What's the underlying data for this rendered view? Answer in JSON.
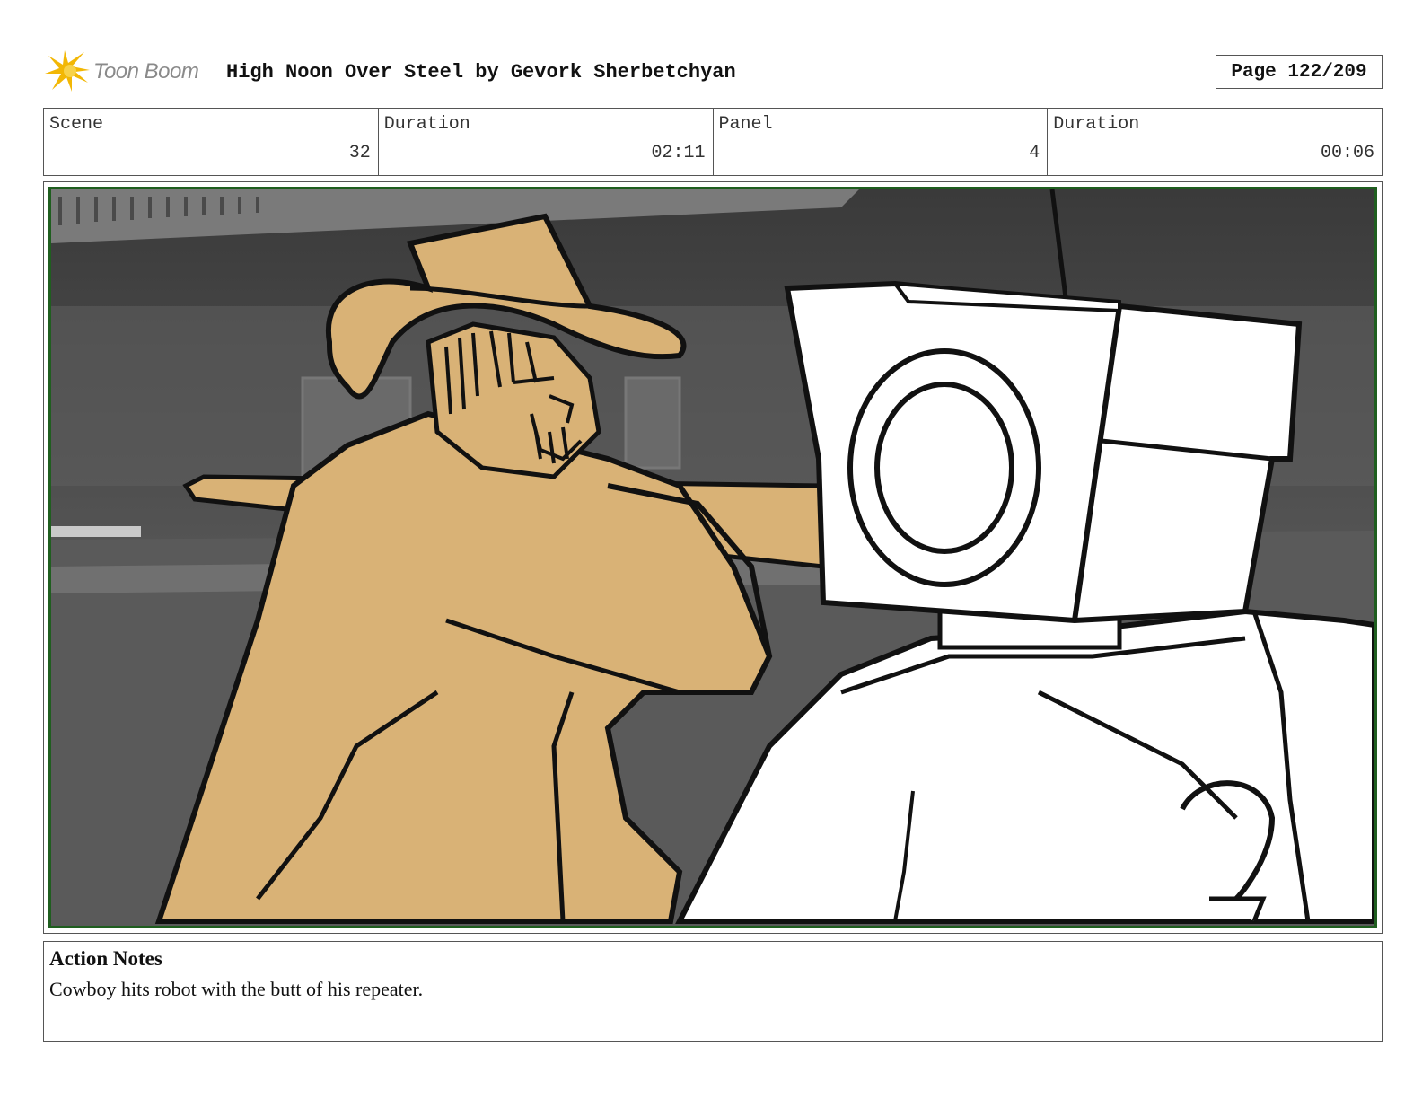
{
  "header": {
    "logo_text": "Toon Boom",
    "title": "High Noon Over Steel by Gevork Sherbetchyan",
    "page": "Page 122/209"
  },
  "info": {
    "scene_label": "Scene",
    "scene_value": "32",
    "scene_duration_label": "Duration",
    "scene_duration_value": "02:11",
    "panel_label": "Panel",
    "panel_value": "4",
    "panel_duration_label": "Duration",
    "panel_duration_value": "00:06"
  },
  "notes": {
    "title": "Action Notes",
    "text": "Cowboy hits robot with the butt of his repeater."
  },
  "colors": {
    "frame_border": "#1f5e1f",
    "cowboy_fill": "#d9b276",
    "logo_star": "#f2b705"
  }
}
